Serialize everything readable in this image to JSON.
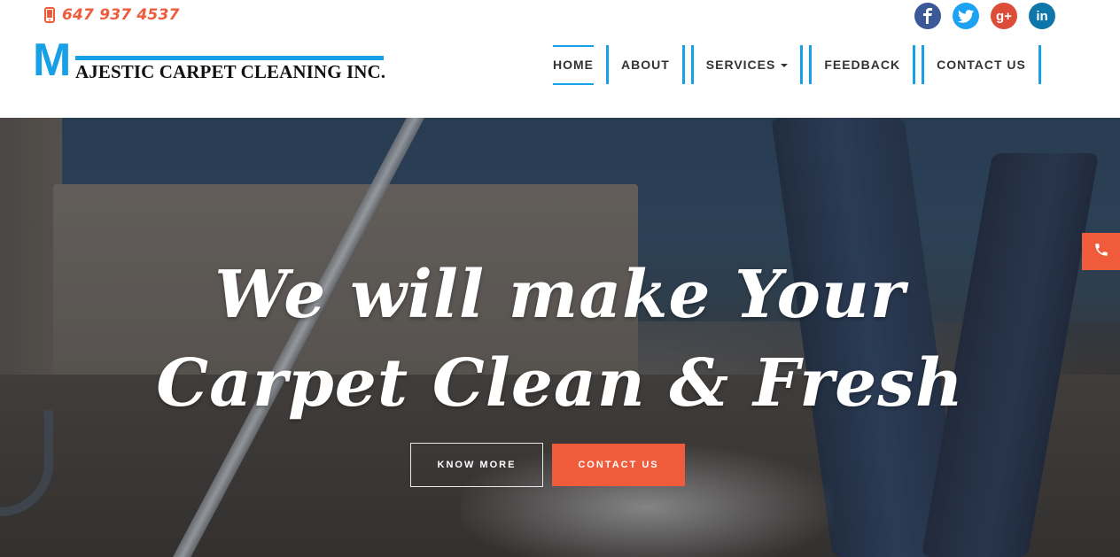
{
  "topbar": {
    "phone_number": "647 937 4537",
    "phone_icon": "mobile-phone-icon"
  },
  "socials": [
    {
      "name": "facebook-icon",
      "glyph": "f",
      "color": "#3b5998"
    },
    {
      "name": "twitter-icon",
      "glyph": "t",
      "color": "#1da1f2"
    },
    {
      "name": "google-plus-icon",
      "glyph": "g+",
      "color": "#dd4b39"
    },
    {
      "name": "linkedin-icon",
      "glyph": "in",
      "color": "#0e76a8"
    }
  ],
  "logo": {
    "initial": "M",
    "rest": "AJESTIC CARPET CLEANING INC."
  },
  "nav": {
    "items": [
      {
        "label": "HOME",
        "active": true
      },
      {
        "label": "ABOUT"
      },
      {
        "label": "SERVICES"
      },
      {
        "label": "FEEDBACK"
      },
      {
        "label": "CONTACT US"
      }
    ]
  },
  "hero": {
    "title_line1": "We will make Your",
    "title_line2": "Carpet Clean & Fresh",
    "know_more_label": "KNOW MORE",
    "contact_label": "CONTACT US"
  },
  "side_call": {
    "icon": "phone-icon"
  },
  "colors": {
    "accent_blue": "#18a0e7",
    "accent_orange": "#ef5b3b"
  }
}
